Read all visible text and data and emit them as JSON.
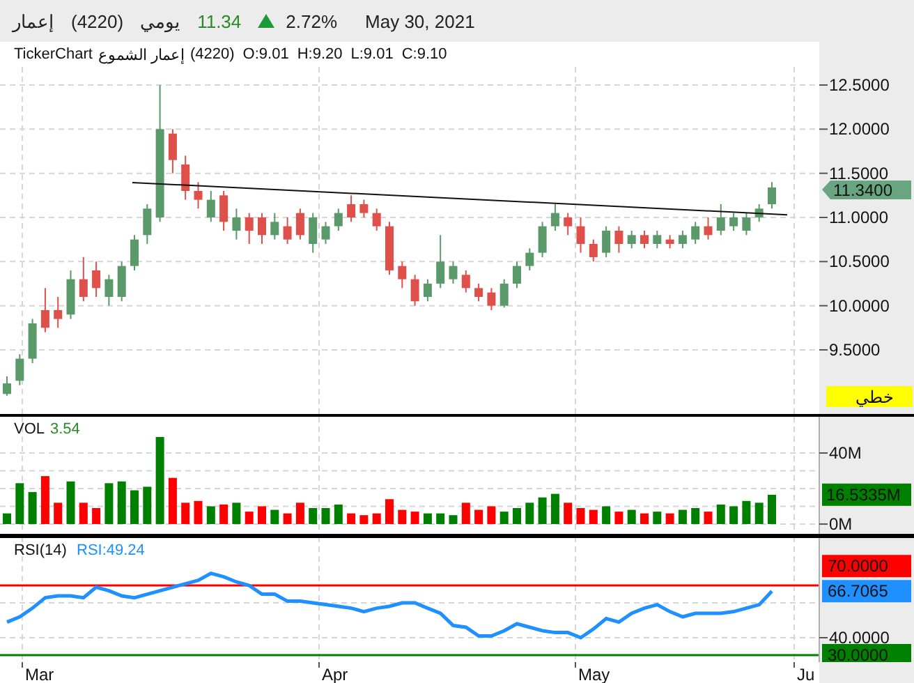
{
  "header": {
    "symbol_name": "إعمار",
    "symbol_code": "(4220)",
    "period": "يومي",
    "last_price": "11.34",
    "rising": true,
    "change_percent": "2.72%",
    "date": "May 30, 2021"
  },
  "price_panel": {
    "legend": {
      "title": "TickerChart",
      "name": "إعمار الشموع",
      "code": "(4220)",
      "ohlc": [
        "O:9.01",
        "H:9.20",
        "L:9.01",
        "C:9.10"
      ]
    },
    "axis_labels": [
      "12.5000",
      "12.0000",
      "11.5000",
      "11.0000",
      "10.5000",
      "10.0000",
      "9.5000"
    ],
    "price_badge": "11.3400",
    "chart_type_button": "خطي"
  },
  "volume_panel": {
    "label": "VOL",
    "value": "3.54",
    "badge": "16.5335M",
    "chart_data": {
      "type": "bar",
      "categories": [
        null,
        null,
        null,
        null,
        null,
        null,
        null,
        null,
        null,
        null,
        null,
        null,
        null,
        null,
        null,
        null,
        null,
        null,
        null,
        null,
        null,
        null,
        null,
        null,
        null,
        null,
        null,
        null,
        null,
        null,
        null,
        null,
        null,
        null,
        null,
        null,
        null,
        null,
        null,
        null,
        null,
        null,
        null,
        null,
        null,
        null,
        null,
        null,
        null,
        null,
        null,
        null,
        null,
        null,
        null,
        null,
        null,
        null,
        null,
        null,
        null
      ],
      "ylim": [
        -6.3,
        60.4
      ],
      "yticks": [
        {
          "value": 0,
          "label": "0M"
        },
        {
          "value": 40,
          "label": "40M"
        }
      ],
      "stacked": true,
      "series": [
        {
          "color": "#008000",
          "values": [
            6,
            23,
            18,
            0,
            0,
            24,
            0,
            0,
            23,
            24,
            19,
            21,
            49,
            0,
            0,
            0,
            10,
            0,
            12,
            0,
            0,
            8,
            0,
            0,
            9,
            9,
            11,
            0,
            0,
            0,
            0,
            0,
            0,
            6,
            6,
            5,
            0,
            0,
            0,
            7,
            9,
            12,
            15,
            17,
            0,
            0,
            0,
            10,
            0,
            8,
            0,
            7,
            0,
            8,
            9,
            0,
            11,
            10,
            13,
            12,
            16.5
          ]
        },
        {
          "color": "#ff0000",
          "values": [
            0,
            0,
            0,
            27,
            12,
            0,
            12,
            9,
            0,
            0,
            0,
            0,
            0,
            26,
            12,
            13,
            0,
            11,
            0,
            7,
            10,
            0,
            6,
            12,
            0,
            0,
            0,
            6,
            5,
            6,
            14,
            8,
            7,
            0,
            0,
            0,
            12,
            8,
            10,
            0,
            0,
            0,
            0,
            0,
            12,
            9,
            8,
            0,
            7,
            0,
            6,
            0,
            6,
            0,
            0,
            7,
            0,
            0,
            0,
            0,
            0
          ]
        }
      ]
    }
  },
  "rsi_panel": {
    "label": "RSI(14)",
    "value": "RSI:49.24",
    "current_badge": "66.7065",
    "levels": [
      {
        "kind": "labelled",
        "label": "70.0000",
        "color": "#ff0000"
      },
      {
        "kind": "first_tick",
        "color": "#008000"
      }
    ],
    "chart_data": {
      "type": "line",
      "ylim": [
        26,
        98
      ],
      "yticks": [
        {
          "value": 30,
          "label": "30.0000"
        },
        {
          "value": 40,
          "label": "40.0000"
        }
      ],
      "categories": [
        null,
        null,
        null,
        null,
        null,
        null,
        null,
        null,
        null,
        null,
        null,
        null,
        null,
        null,
        null,
        null,
        null,
        null,
        null,
        null,
        null,
        null,
        null,
        null,
        null,
        null,
        null,
        null,
        null,
        null,
        null,
        null,
        null,
        null,
        null,
        null,
        null,
        null,
        null,
        null,
        null,
        null,
        null,
        null,
        null,
        null,
        null,
        null,
        null,
        null,
        null,
        null,
        null,
        null,
        null,
        null,
        null,
        null,
        null,
        null,
        null
      ],
      "series": [
        {
          "color": "#1e90ff",
          "values": [
            49,
            52,
            57,
            63,
            64,
            64,
            63,
            69,
            67,
            64,
            63,
            65,
            67,
            69,
            71,
            73,
            77,
            75,
            72,
            70,
            65,
            65,
            61,
            61,
            60,
            59,
            58,
            57,
            55,
            57,
            58,
            60,
            60,
            57,
            54,
            47,
            46,
            41,
            41,
            44,
            48,
            46,
            44,
            43,
            43,
            40,
            45,
            51,
            49,
            54,
            57,
            59,
            55,
            52,
            54,
            54,
            54,
            55,
            57,
            59,
            66.7
          ]
        }
      ]
    }
  },
  "x_axis": [
    "Mar",
    "Apr",
    "May",
    "Ju"
  ]
}
